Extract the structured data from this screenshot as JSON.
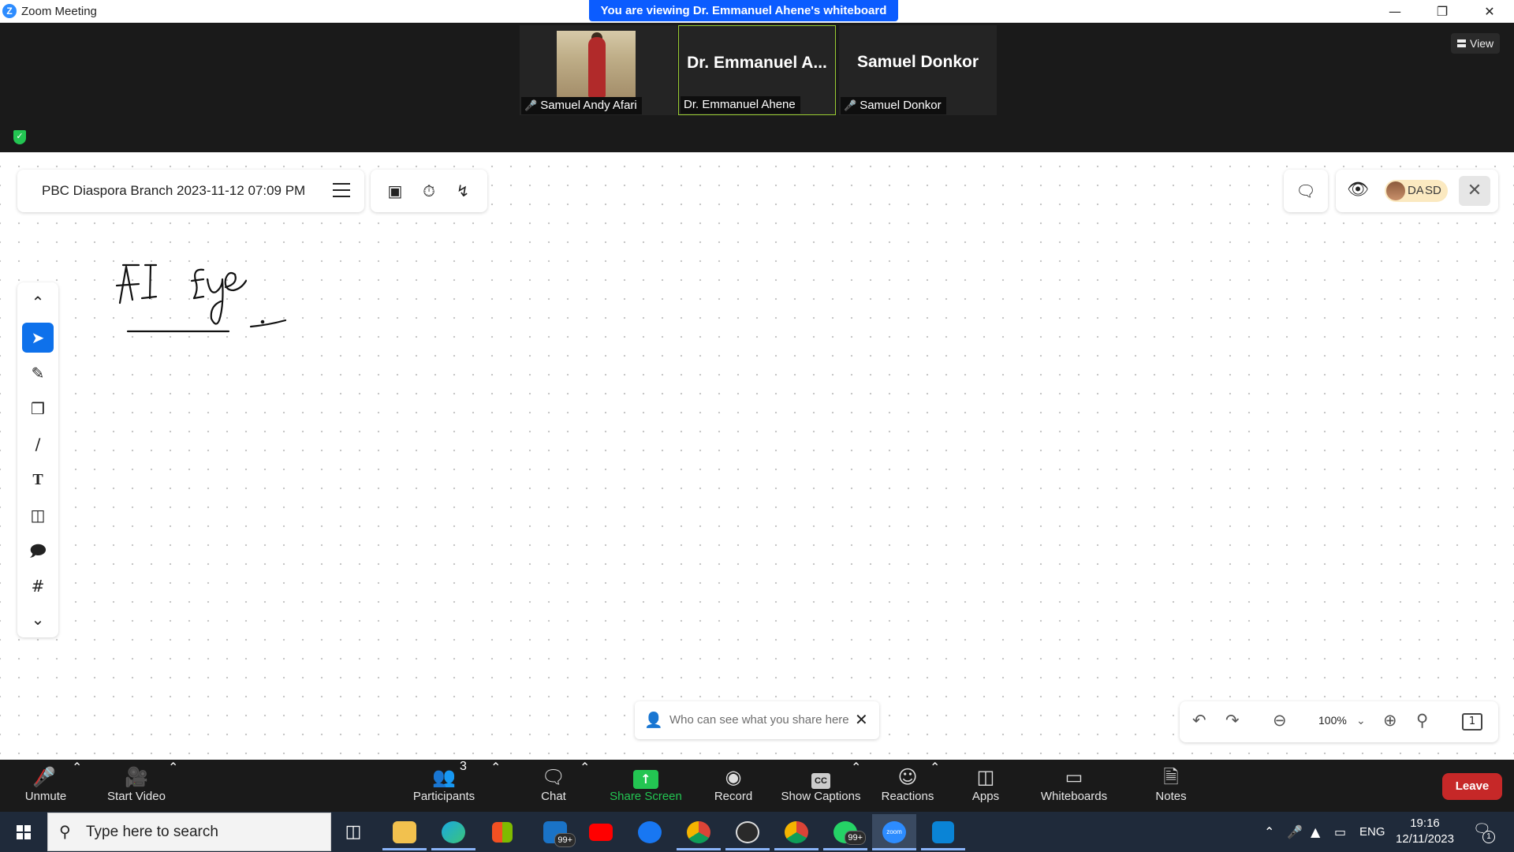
{
  "window": {
    "title": "Zoom Meeting",
    "app_logo": "Z",
    "viewing_banner": "You are viewing Dr. Emmanuel Ahene's whiteboard"
  },
  "video_strip": {
    "view_label": "View",
    "participants": [
      {
        "name": "Samuel Andy Afari",
        "has_video": true,
        "muted": true
      },
      {
        "name": "Dr. Emmanuel Ahene",
        "display_big": "Dr. Emmanuel A...",
        "has_video": false,
        "muted": false,
        "active_speaker": true
      },
      {
        "name": "Samuel Donkor",
        "display_big": "Samuel Donkor",
        "has_video": false,
        "muted": true
      }
    ]
  },
  "whiteboard": {
    "title": "PBC Diaspora Branch 2023-11-12 07:09 PM",
    "collaborators": {
      "initials": [
        "DA",
        "SD"
      ]
    },
    "handwriting": "AI Eye",
    "share_notice": "Who can see what you share here",
    "zoom_level": "100%",
    "page_badge": "1"
  },
  "controls": {
    "unmute": "Unmute",
    "start_video": "Start Video",
    "participants": "Participants",
    "participants_count": "3",
    "chat": "Chat",
    "share_screen": "Share Screen",
    "record": "Record",
    "captions_badge": "CC",
    "show_captions": "Show Captions",
    "reactions": "Reactions",
    "apps": "Apps",
    "whiteboards": "Whiteboards",
    "notes": "Notes",
    "leave": "Leave"
  },
  "taskbar": {
    "search_placeholder": "Type here to search",
    "mail_badge": "99+",
    "whatsapp_badge": "99+",
    "zoom_label": "zoom",
    "lang": "ENG",
    "time": "19:16",
    "date": "12/11/2023",
    "notification_count": "1"
  },
  "colors": {
    "zoom_blue": "#0b5cff",
    "share_green": "#23c552",
    "leave_red": "#c62828",
    "active_tool_blue": "#0e71eb",
    "mute_red": "#e02828"
  }
}
